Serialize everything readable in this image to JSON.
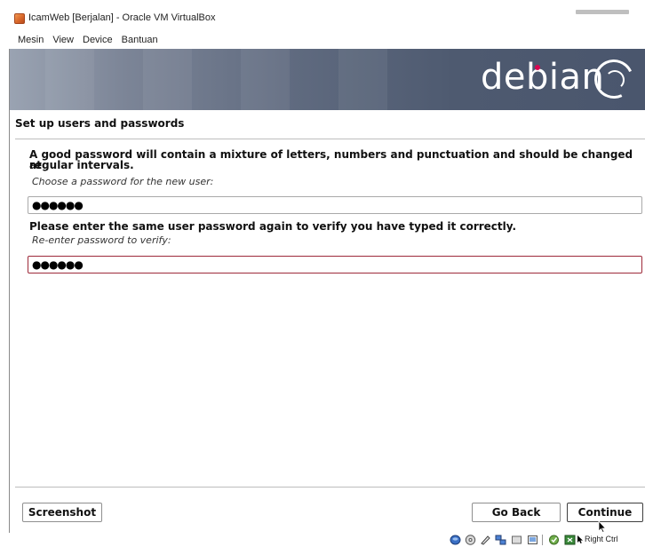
{
  "window": {
    "title": "IcamWeb [Berjalan] - Oracle VM VirtualBox"
  },
  "menubar": {
    "items": [
      "Mesin",
      "View",
      "Device",
      "Bantuan"
    ]
  },
  "banner": {
    "logo_text": "debian"
  },
  "installer": {
    "section_title": "Set up users and passwords",
    "intro_line1": "A good password will contain a mixture of letters, numbers and punctuation and should be changed at",
    "intro_line2": "regular intervals.",
    "password_prompt": "Choose a password for the new user:",
    "password_value": "●●●●●●",
    "verify_instruction": "Please enter the same user password again to verify you have typed it correctly.",
    "verify_prompt": "Re-enter password to verify:",
    "verify_value": "●●●●●●"
  },
  "buttons": {
    "screenshot": "Screenshot",
    "go_back": "Go Back",
    "continue": "Continue"
  },
  "statusbar": {
    "icons": [
      "hard-disk-icon",
      "optical-drive-icon",
      "audio-icon",
      "network-icon",
      "usb-icon",
      "shared-folder-icon",
      "display-icon",
      "recording-icon",
      "mouse-integration-icon"
    ],
    "host_key": "Right Ctrl"
  },
  "colors": {
    "banner_dark": "#4e5a70",
    "debian_red": "#d70751",
    "focus_border": "#9e2a3a",
    "status_icon": "#2b5fb4"
  }
}
